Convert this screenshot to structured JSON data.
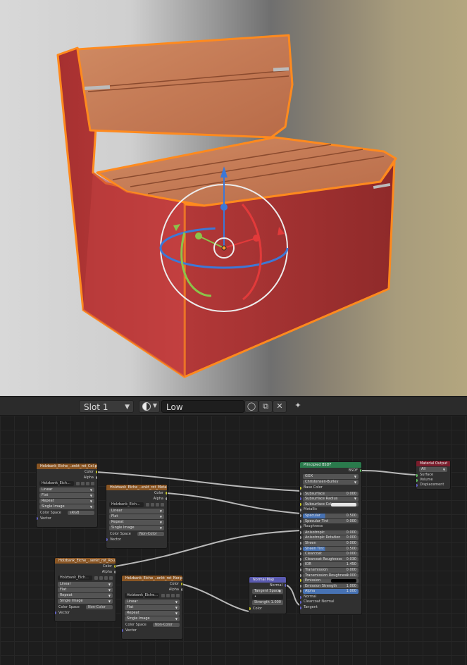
{
  "header": {
    "slot_label": "Slot 1",
    "material_name": "Low",
    "buttons": [
      "fake-user-icon",
      "copy-icon",
      "close-icon",
      "pin-icon"
    ]
  },
  "nodes": {
    "tex1": {
      "title": "Holzbank_Eiche_..enkt_rot_Col.png",
      "out_color": "Color",
      "out_alpha": "Alpha",
      "image": "Holzbank_Eich...",
      "interpolation": "Linear",
      "projection": "Flat",
      "extension": "Repeat",
      "source": "Single Image",
      "color_space_label": "Color Space",
      "color_space": "sRGB",
      "vector": "Vector"
    },
    "tex2": {
      "title": "Holzbank_Eiche_..enkt_rot_Metal.pn",
      "out_color": "Color",
      "out_alpha": "Alpha",
      "image": "Holzbank_Eich...",
      "interpolation": "Linear",
      "projection": "Flat",
      "extension": "Repeat",
      "source": "Single Image",
      "color_space_label": "Color Space",
      "color_space": "Non-Color",
      "vector": "Vector"
    },
    "tex3": {
      "title": "Holzbank_Eiche_..senkt_rot_Rou.pn",
      "out_color": "Color",
      "out_alpha": "Alpha",
      "image": "Holzbank_Eich...",
      "interpolation": "Linear",
      "projection": "Flat",
      "extension": "Repeat",
      "source": "Single Image",
      "color_space_label": "Color Space",
      "color_space": "Non-Color",
      "vector": "Vector"
    },
    "tex4": {
      "title": "Holzbank_Eiche_..enkt_rot_Nor.pn",
      "out_color": "Color",
      "out_alpha": "Alpha",
      "image": "Holzbank_Eiche...",
      "interpolation": "Linear",
      "projection": "Flat",
      "extension": "Repeat",
      "source": "Single Image",
      "color_space_label": "Color Space",
      "color_space": "Non-Color",
      "vector": "Vector"
    },
    "normal": {
      "title": "Normal Map",
      "out_normal": "Normal",
      "space": "Tangent Space",
      "strength_label": "Strength",
      "strength": "1.000",
      "in_color": "Color"
    },
    "bsdf": {
      "title": "Principled BSDF",
      "out": "BSDF",
      "distribution": "GGX",
      "subsurface_method": "Christensen-Burley",
      "inputs": [
        {
          "label": "Base Color",
          "kind": "socket"
        },
        {
          "label": "Subsurface",
          "value": "0.000"
        },
        {
          "label": "Subsurface Radius",
          "kind": "dropdown"
        },
        {
          "label": "Subsurface Colo",
          "kind": "swatch",
          "color": "#e6e6e6"
        },
        {
          "label": "Metallic",
          "kind": "socket"
        },
        {
          "label": "Specular",
          "value": "0.500",
          "kind": "blue"
        },
        {
          "label": "Specular Tint",
          "value": "0.000"
        },
        {
          "label": "Roughness",
          "kind": "socket"
        },
        {
          "label": "Anisotropic",
          "value": "0.000"
        },
        {
          "label": "Anisotropic Rotation",
          "value": "0.000"
        },
        {
          "label": "Sheen",
          "value": "0.000"
        },
        {
          "label": "Sheen Tint",
          "value": "0.500",
          "kind": "blue"
        },
        {
          "label": "Clearcoat",
          "value": "0.000"
        },
        {
          "label": "Clearcoat Roughness",
          "value": "0.030"
        },
        {
          "label": "IOR",
          "value": "1.450"
        },
        {
          "label": "Transmission",
          "value": "0.000"
        },
        {
          "label": "Transmission Roughness",
          "value": "0.000"
        },
        {
          "label": "Emission",
          "kind": "swatch",
          "color": "#000000"
        },
        {
          "label": "Emission Strength",
          "value": "1.000"
        },
        {
          "label": "Alpha",
          "value": "1.000",
          "kind": "blue2"
        },
        {
          "label": "Normal",
          "kind": "socket"
        },
        {
          "label": "Clearcoat Normal",
          "kind": "socket"
        },
        {
          "label": "Tangent",
          "kind": "socket"
        }
      ]
    },
    "output": {
      "title": "Material Output",
      "target": "All",
      "inputs": [
        "Surface",
        "Volume",
        "Displacement"
      ]
    }
  },
  "colors": {
    "bench_red": "#b03a32",
    "bench_wood": "#c9805a",
    "outline": "#ff8a1e",
    "texture_header": "#8a5624",
    "shader_header": "#2a7a4c",
    "vector_header": "#5a5ab0",
    "output_header": "#7a1d2c"
  }
}
